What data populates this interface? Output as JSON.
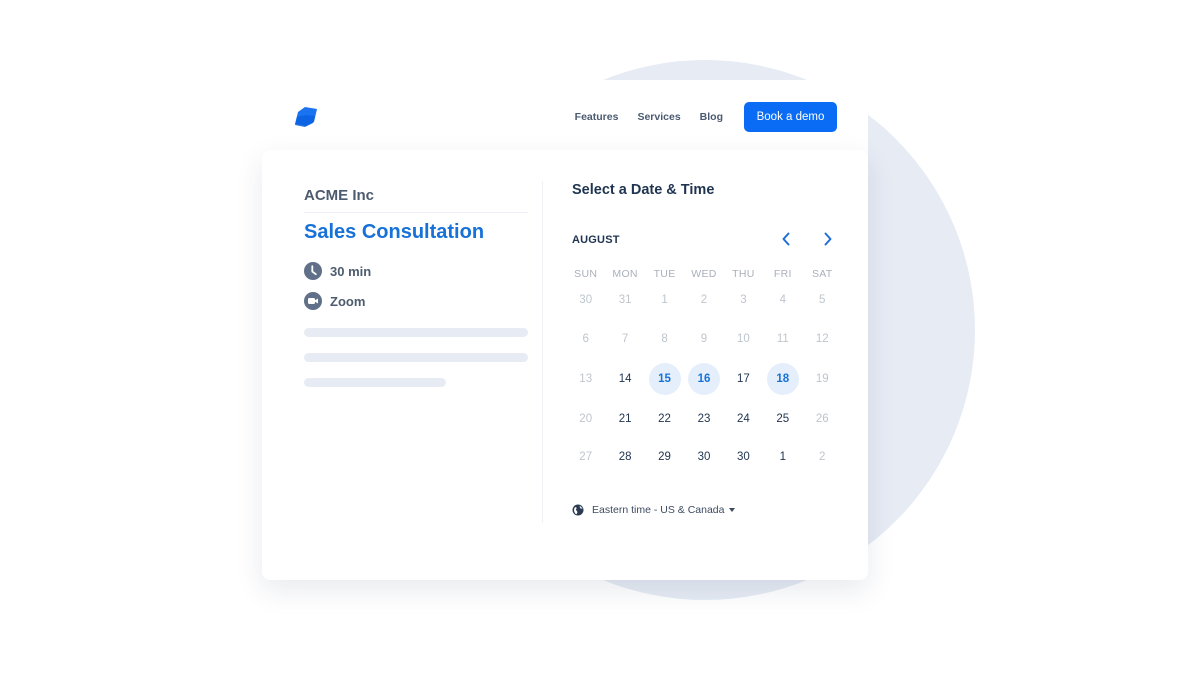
{
  "colors": {
    "accent": "#0a6cf5",
    "title_blue": "#1671d8",
    "available_bg": "#e5effc",
    "background_circle": "#e6ebf4"
  },
  "header": {
    "logo_icon": "brand-logo-icon",
    "nav": [
      {
        "label": "Features"
      },
      {
        "label": "Services"
      },
      {
        "label": "Blog"
      }
    ],
    "cta_label": "Book a demo"
  },
  "event": {
    "company": "ACME Inc",
    "title": "Sales Consultation",
    "duration": {
      "icon": "clock-icon",
      "label": "30 min"
    },
    "location": {
      "icon": "video-camera-icon",
      "label": "Zoom"
    }
  },
  "scheduler": {
    "title": "Select a Date & Time",
    "month": "AUGUST",
    "prev_icon": "chevron-left-icon",
    "next_icon": "chevron-right-icon",
    "weekdays": [
      "SUN",
      "MON",
      "TUE",
      "WED",
      "THU",
      "FRI",
      "SAT"
    ],
    "weeks": [
      [
        {
          "label": "30",
          "state": "muted"
        },
        {
          "label": "31",
          "state": "muted"
        },
        {
          "label": "1",
          "state": "muted"
        },
        {
          "label": "2",
          "state": "muted"
        },
        {
          "label": "3",
          "state": "muted"
        },
        {
          "label": "4",
          "state": "muted"
        },
        {
          "label": "5",
          "state": "muted"
        }
      ],
      [
        {
          "label": "6",
          "state": "muted"
        },
        {
          "label": "7",
          "state": "muted"
        },
        {
          "label": "8",
          "state": "muted"
        },
        {
          "label": "9",
          "state": "muted"
        },
        {
          "label": "10",
          "state": "muted"
        },
        {
          "label": "11",
          "state": "muted"
        },
        {
          "label": "12",
          "state": "muted"
        }
      ],
      [
        {
          "label": "13",
          "state": "muted"
        },
        {
          "label": "14",
          "state": "active"
        },
        {
          "label": "15",
          "state": "available"
        },
        {
          "label": "16",
          "state": "available"
        },
        {
          "label": "17",
          "state": "active"
        },
        {
          "label": "18",
          "state": "available"
        },
        {
          "label": "19",
          "state": "muted"
        }
      ],
      [
        {
          "label": "20",
          "state": "muted"
        },
        {
          "label": "21",
          "state": "active"
        },
        {
          "label": "22",
          "state": "active"
        },
        {
          "label": "23",
          "state": "active"
        },
        {
          "label": "24",
          "state": "active"
        },
        {
          "label": "25",
          "state": "active"
        },
        {
          "label": "26",
          "state": "muted"
        }
      ],
      [
        {
          "label": "27",
          "state": "muted"
        },
        {
          "label": "28",
          "state": "active"
        },
        {
          "label": "29",
          "state": "active"
        },
        {
          "label": "30",
          "state": "active"
        },
        {
          "label": "30",
          "state": "active"
        },
        {
          "label": "1",
          "state": "active"
        },
        {
          "label": "2",
          "state": "muted"
        }
      ]
    ],
    "timezone": {
      "icon": "globe-icon",
      "label": "Eastern time - US & Canada"
    }
  }
}
